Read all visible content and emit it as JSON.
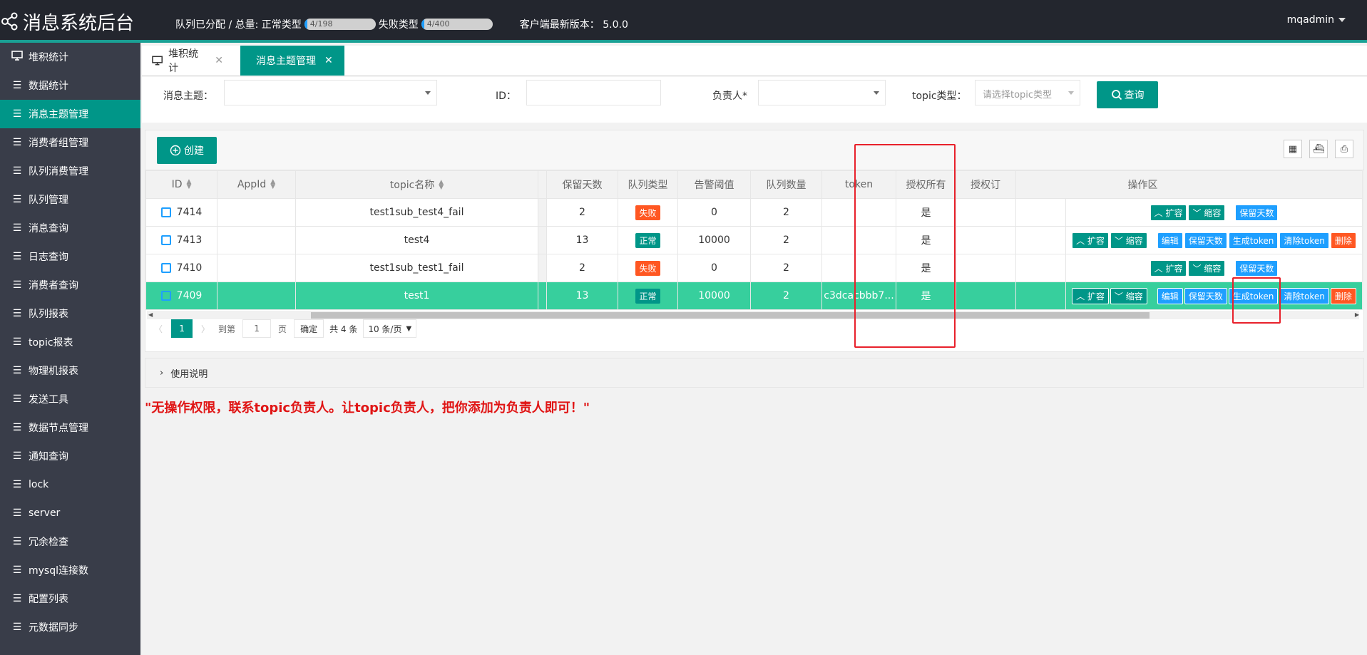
{
  "header": {
    "title": "消息系统后台",
    "stats_label": "队列已分配 / 总量: 正常类型",
    "normal_bar": "4/198",
    "normal_progress": 0.02,
    "fail_label": "失败类型",
    "fail_bar": "4/400",
    "fail_progress": 0.01,
    "version_label": "客户端最新版本： 5.0.0",
    "user": "mqadmin"
  },
  "sidebar": {
    "items": [
      {
        "label": "堆积统计",
        "icon": "monitor-icon"
      },
      {
        "label": "数据统计",
        "icon": "list-icon"
      },
      {
        "label": "消息主题管理",
        "icon": "list-icon"
      },
      {
        "label": "消费者组管理",
        "icon": "list-icon"
      },
      {
        "label": "队列消费管理",
        "icon": "list-icon"
      },
      {
        "label": "队列管理",
        "icon": "list-icon"
      },
      {
        "label": "消息查询",
        "icon": "list-icon"
      },
      {
        "label": "日志查询",
        "icon": "list-icon"
      },
      {
        "label": "消费者查询",
        "icon": "list-icon"
      },
      {
        "label": "队列报表",
        "icon": "list-icon"
      },
      {
        "label": "topic报表",
        "icon": "list-icon"
      },
      {
        "label": "物理机报表",
        "icon": "list-icon"
      },
      {
        "label": "发送工具",
        "icon": "list-icon"
      },
      {
        "label": "数据节点管理",
        "icon": "list-icon"
      },
      {
        "label": "通知查询",
        "icon": "list-icon"
      },
      {
        "label": "lock",
        "icon": "list-icon"
      },
      {
        "label": "server",
        "icon": "list-icon"
      },
      {
        "label": "冗余检查",
        "icon": "list-icon"
      },
      {
        "label": "mysql连接数",
        "icon": "list-icon"
      },
      {
        "label": "配置列表",
        "icon": "list-icon"
      },
      {
        "label": "元数据同步",
        "icon": "list-icon"
      }
    ],
    "active_index": 2
  },
  "tabs": [
    {
      "label": "堆积统计"
    },
    {
      "label": "消息主题管理"
    }
  ],
  "search": {
    "topic_label": "消息主题：",
    "id_label": "ID：",
    "owner_label": "负责人*",
    "type_label": "topic类型：",
    "type_placeholder": "请选择topic类型",
    "query_label": "查询"
  },
  "toolbar": {
    "create_label": "创建"
  },
  "table": {
    "headers": [
      "ID",
      "AppId",
      "topic名称",
      "保留天数",
      "队列类型",
      "告警阈值",
      "队列数量",
      "token",
      "授权所有",
      "授权订",
      "操作区"
    ],
    "rows": [
      {
        "id": "7414",
        "appid": "",
        "name": "test1sub_test4_fail",
        "days": "2",
        "type": "失败",
        "alarm": "0",
        "queues": "2",
        "token": "",
        "auth": "是",
        "ops": [
          "扩容",
          "缩容",
          "保留天数"
        ]
      },
      {
        "id": "7413",
        "appid": "",
        "name": "test4",
        "days": "13",
        "type": "正常",
        "alarm": "10000",
        "queues": "2",
        "token": "",
        "auth": "是",
        "ops": [
          "扩容",
          "缩容",
          "编辑",
          "保留天数",
          "生成token",
          "清除token",
          "删除"
        ]
      },
      {
        "id": "7410",
        "appid": "",
        "name": "test1sub_test1_fail",
        "days": "2",
        "type": "失败",
        "alarm": "0",
        "queues": "2",
        "token": "",
        "auth": "是",
        "ops": [
          "扩容",
          "缩容",
          "保留天数"
        ]
      },
      {
        "id": "7409",
        "appid": "",
        "name": "test1",
        "days": "13",
        "type": "正常",
        "alarm": "10000",
        "queues": "2",
        "token": "c3dcacbbb7...",
        "auth": "是",
        "ops": [
          "扩容",
          "缩容",
          "编辑",
          "保留天数",
          "生成token",
          "清除token",
          "删除"
        ]
      }
    ]
  },
  "pager": {
    "current": "1",
    "goto_label": "到第",
    "goto_value": "1",
    "page_unit": "页",
    "confirm": "确定",
    "total": "共 4 条",
    "size": "10 条/页"
  },
  "help_label": "使用说明",
  "warning": "\"无操作权限，联系topic负责人。让topic负责人，把你添加为负责人即可！\"",
  "colors": {
    "accent": "#009688",
    "header_bg": "#23262e",
    "sidebar_bg": "#393d49",
    "selected_row": "#37cf9d",
    "fail": "#ff5722",
    "blue": "#1e9fff",
    "annotation": "#e8212b"
  }
}
